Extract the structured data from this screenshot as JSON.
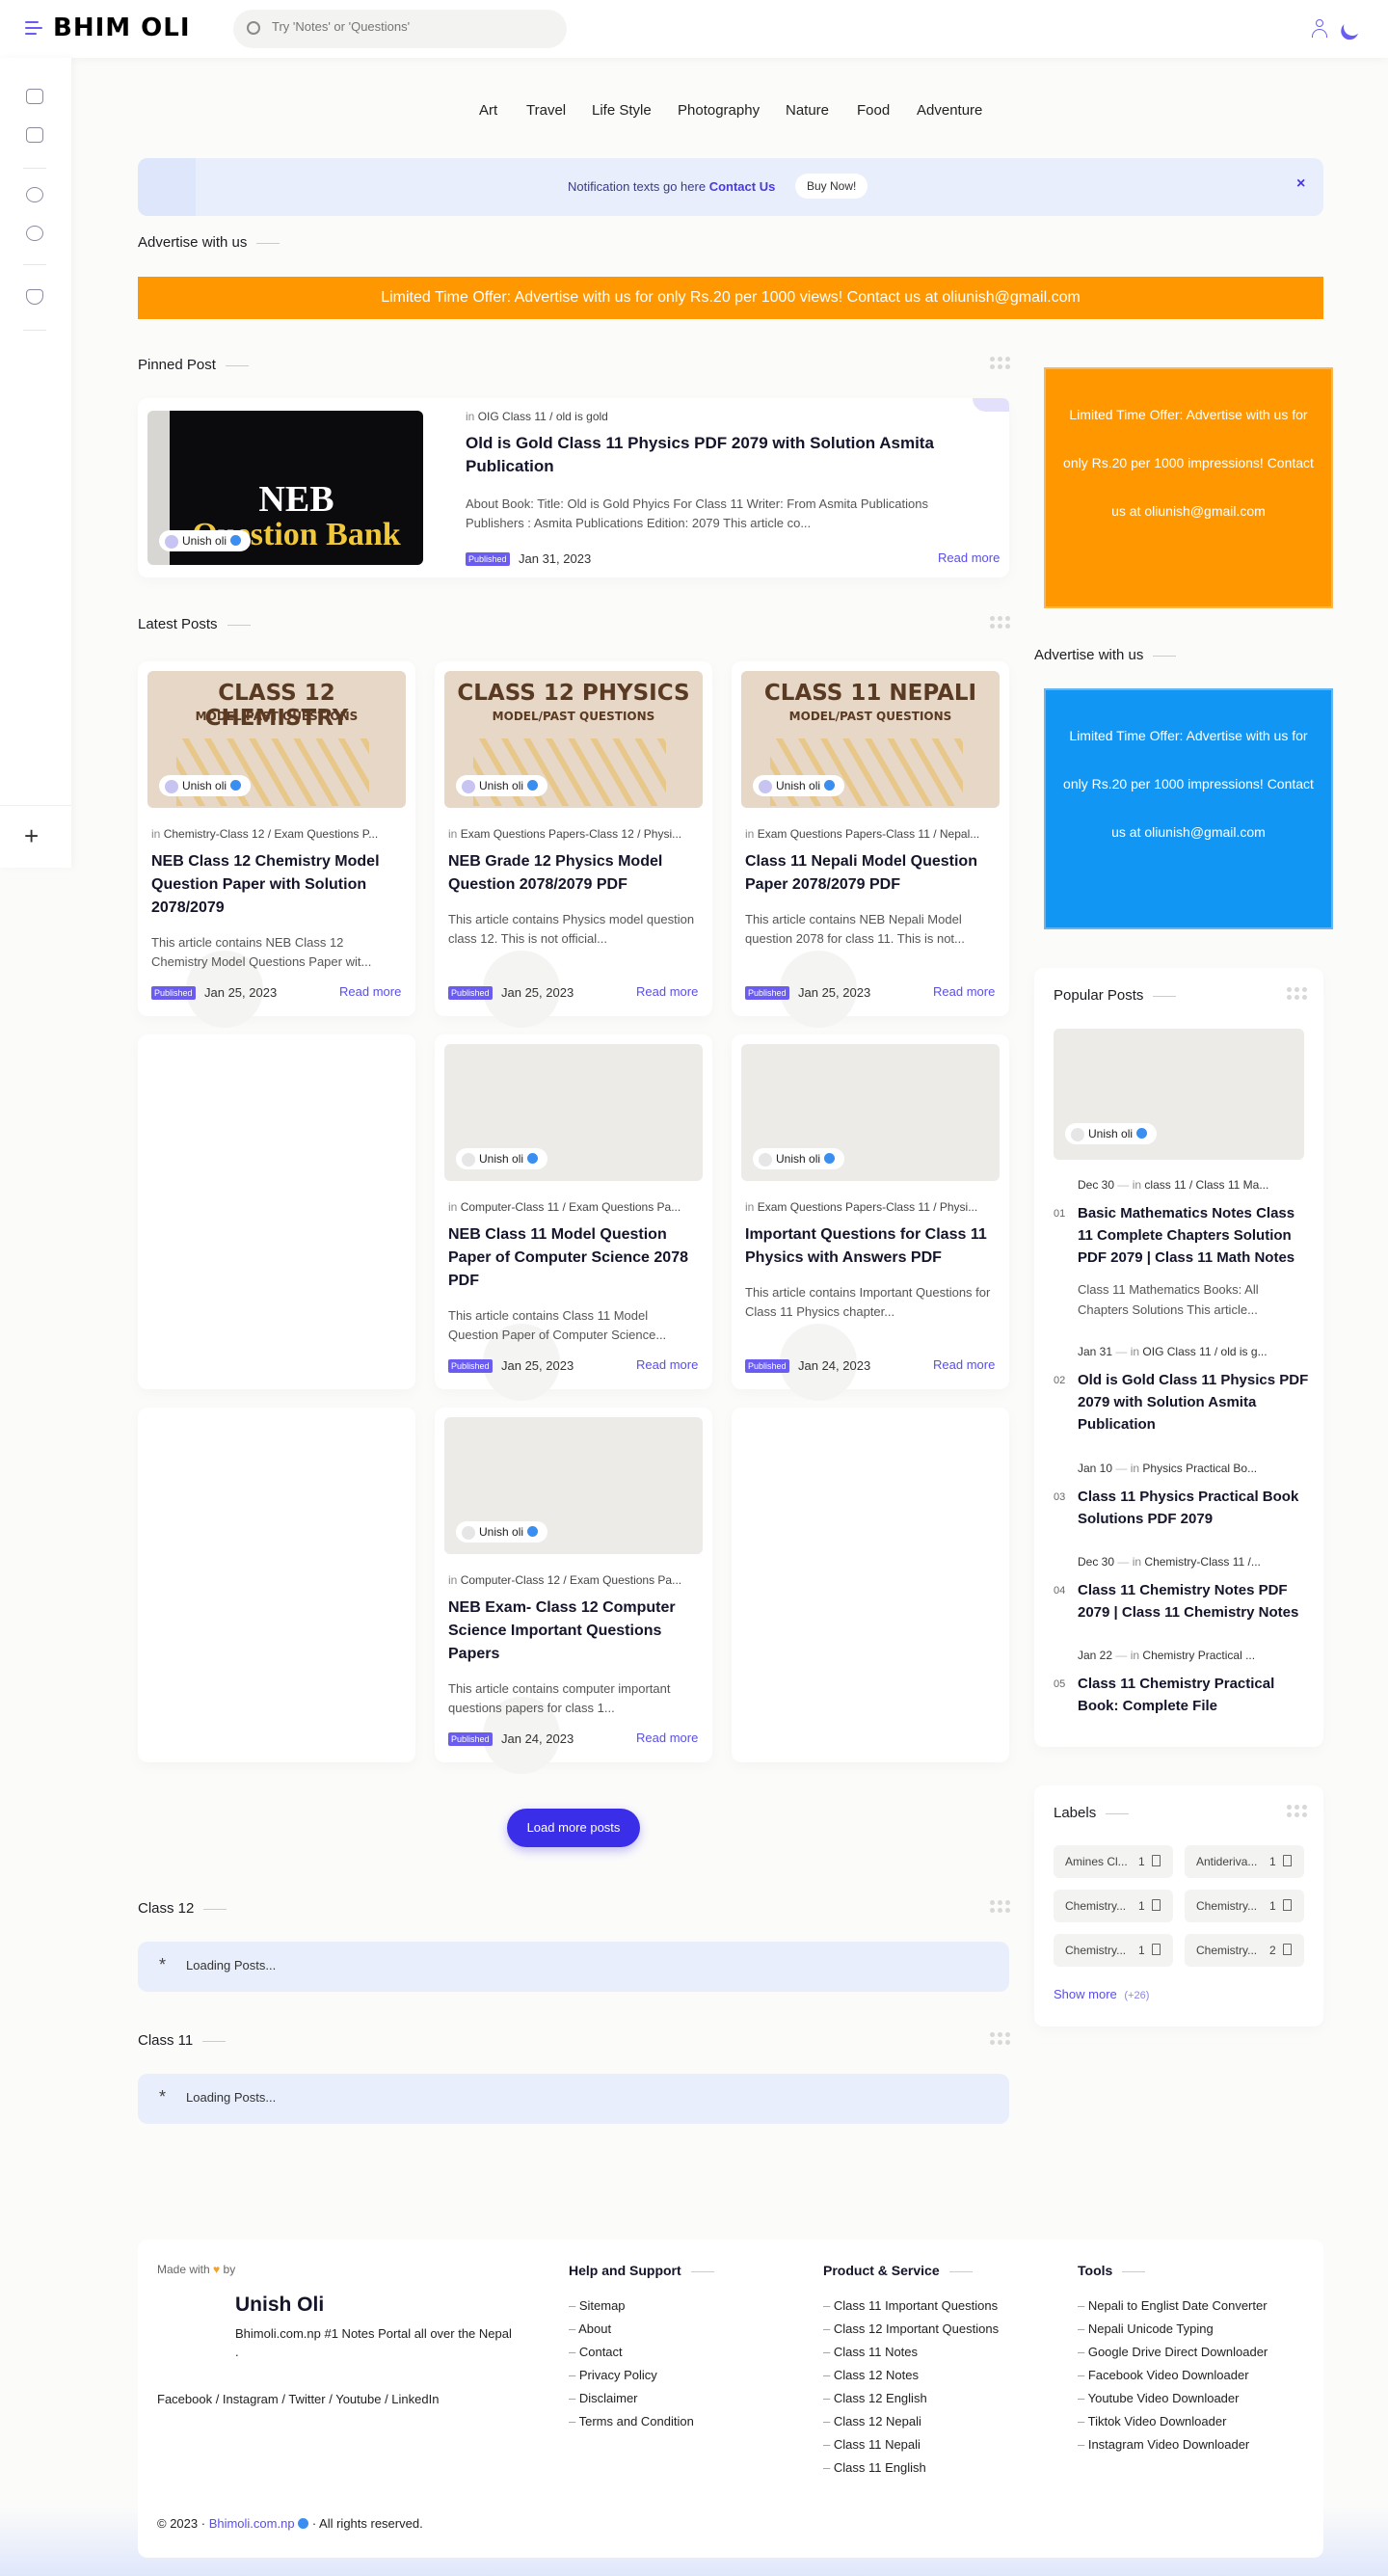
{
  "header": {
    "logo": "BHIM OLI",
    "search_placeholder": "Try 'Notes' or 'Questions'"
  },
  "nav": [
    "Art",
    "Travel",
    "Life Style",
    "Photography",
    "Nature",
    "Food",
    "Adventure"
  ],
  "notification": {
    "text": "Notification texts go here",
    "link": "Contact Us",
    "button": "Buy Now!",
    "close": "×"
  },
  "advertise": {
    "title": "Advertise with us",
    "banner": "Limited Time Offer: Advertise with us for only Rs.20 per 1000 views! Contact us at oliunish@gmail.com"
  },
  "pinned": {
    "title": "Pinned Post",
    "thumb_title": "NEB",
    "thumb_sub": "Question Bank",
    "author": "Unish oli",
    "cat_prefix": "in",
    "category": "OIG Class 11 / old is gold",
    "post_title": "Old is Gold Class 11 Physics PDF 2079 with Solution Asmita Publication",
    "desc": "About Book: Title: Old is Gold Phyics For Class 11 Writer: From Asmita Publications Publishers : Asmita Publications Edition: 2079 This article co...",
    "badge": "Published",
    "date": "Jan 31, 2023",
    "read_more": "Read more"
  },
  "latest": {
    "title": "Latest Posts",
    "posts": [
      {
        "thumb_title": "CLASS 12 CHEMISTRY",
        "thumb_sub": "MODEL/PAST QUESTIONS",
        "author": "Unish oli",
        "category": "Chemistry-Class 12 / Exam Questions P...",
        "title": "NEB Class 12 Chemistry Model Question Paper with Solution 2078/2079",
        "desc": "This article contains NEB Class 12 Chemistry Model Questions Paper wit...",
        "badge": "Published",
        "date": "Jan 25, 2023",
        "read_more": "Read more"
      },
      {
        "thumb_title": "CLASS 12 PHYSICS",
        "thumb_sub": "MODEL/PAST QUESTIONS",
        "author": "Unish oli",
        "category": "Exam Questions Papers-Class 12 / Physi...",
        "title": "NEB Grade 12 Physics Model Question 2078/2079 PDF",
        "desc": "This article contains Physics model question class 12. This is not official...",
        "badge": "Published",
        "date": "Jan 25, 2023",
        "read_more": "Read more"
      },
      {
        "thumb_title": "CLASS 11 NEPALI",
        "thumb_sub": "MODEL/PAST QUESTIONS",
        "author": "Unish oli",
        "category": "Exam Questions Papers-Class 11 / Nepal...",
        "title": "Class 11 Nepali Model Question Paper 2078/2079 PDF",
        "desc": "This article contains  NEB Nepali Model question 2078 for class 11. This is not...",
        "badge": "Published",
        "date": "Jan 25, 2023",
        "read_more": "Read more"
      },
      {
        "author": "Unish oli",
        "category": "Computer-Class 11 / Exam Questions Pa...",
        "title": "NEB Class 11 Model Question Paper of Computer Science 2078 PDF",
        "desc": "This article contains Class 11 Model Question Paper of Computer Science...",
        "badge": "Published",
        "date": "Jan 25, 2023",
        "read_more": "Read more"
      },
      {
        "author": "Unish oli",
        "category": "Exam Questions Papers-Class 11 / Physi...",
        "title": "Important Questions for Class 11 Physics with Answers PDF",
        "desc": "This article contains Important Questions for Class 11 Physics chapter...",
        "badge": "Published",
        "date": "Jan 24, 2023",
        "read_more": "Read more"
      },
      {
        "author": "Unish oli",
        "category": "Computer-Class 12 / Exam Questions Pa...",
        "title": "NEB Exam- Class 12 Computer Science Important Questions Papers",
        "desc": "This article contains computer important questions papers for class 1...",
        "badge": "Published",
        "date": "Jan 24, 2023",
        "read_more": "Read more"
      }
    ],
    "load_more": "Load more posts"
  },
  "class12": {
    "title": "Class 12",
    "loading": "Loading Posts..."
  },
  "class11": {
    "title": "Class 11",
    "loading": "Loading Posts..."
  },
  "side_ad1": {
    "text": "Limited Time Offer: Advertise with us for only Rs.20 per 1000 impressions! Contact us at oliunish@gmail.com",
    "color": "#ff9800"
  },
  "side_adv_title": "Advertise with us",
  "side_ad2": {
    "text": "Limited Time Offer: Advertise with us for only Rs.20 per 1000 impressions! Contact us at oliunish@gmail.com",
    "color": "#1196f3"
  },
  "popular": {
    "title": "Popular Posts",
    "author": "Unish oli",
    "items": [
      {
        "num": "01",
        "date": "Dec 30",
        "cat": "class 11 / Class 11 Ma...",
        "title": "Basic Mathematics Notes Class 11 Complete Chapters Solution PDF 2079 | Class 11 Math Notes",
        "desc": "Class 11 Mathematics Books: All Chapters Solutions  This article..."
      },
      {
        "num": "02",
        "date": "Jan 31",
        "cat": "OIG Class 11 / old is g...",
        "title": "Old is Gold Class 11 Physics PDF 2079 with Solution Asmita Publication"
      },
      {
        "num": "03",
        "date": "Jan 10",
        "cat": "Physics Practical Bo...",
        "title": "Class 11 Physics Practical Book Solutions PDF 2079"
      },
      {
        "num": "04",
        "date": "Dec 30",
        "cat": "Chemistry-Class 11 /...",
        "title": "Class 11 Chemistry Notes PDF 2079 | Class 11 Chemistry Notes"
      },
      {
        "num": "05",
        "date": "Jan 22",
        "cat": "Chemistry Practical ...",
        "title": "Class 11 Chemistry Practical Book: Complete File"
      }
    ]
  },
  "labels": {
    "title": "Labels",
    "items": [
      {
        "name": "Amines Cl...",
        "count": "1"
      },
      {
        "name": "Antideriva...",
        "count": "1"
      },
      {
        "name": "Chemistry...",
        "count": "1"
      },
      {
        "name": "Chemistry...",
        "count": "1"
      },
      {
        "name": "Chemistry...",
        "count": "1"
      },
      {
        "name": "Chemistry...",
        "count": "2"
      }
    ],
    "show_more": "Show more",
    "more_count": "(+26)"
  },
  "footer": {
    "made_with": "Made with",
    "by": "by",
    "name": "Unish Oli",
    "desc": "Bhimoli.com.np #1 Notes Portal all over the Nepal .",
    "social": "Facebook / Instagram / Twitter / Youtube / LinkedIn",
    "help_title": "Help and Support",
    "help": [
      "Sitemap",
      "About",
      "Contact",
      "Privacy Policy",
      "Disclaimer",
      "Terms and Condition"
    ],
    "product_title": "Product & Service",
    "product": [
      "Class 11 Important Questions",
      "Class 12 Important Questions",
      "Class 11 Notes",
      "Class 12 Notes",
      "Class 12 English",
      "Class 12 Nepali",
      "Class 11 Nepali",
      "Class 11 English"
    ],
    "tools_title": "Tools",
    "tools": [
      "Nepali to Englist Date Converter",
      "Nepali Unicode Typing",
      "Google Drive Direct Downloader",
      "Facebook Video Downloader",
      "Youtube Video Downloader",
      "Tiktok Video Downloader",
      "Instagram Video Downloader"
    ],
    "copyright_prefix": "© 2023 ·",
    "copyright_site": "Bhimoli.com.np",
    "copyright_suffix": "· All rights reserved."
  }
}
